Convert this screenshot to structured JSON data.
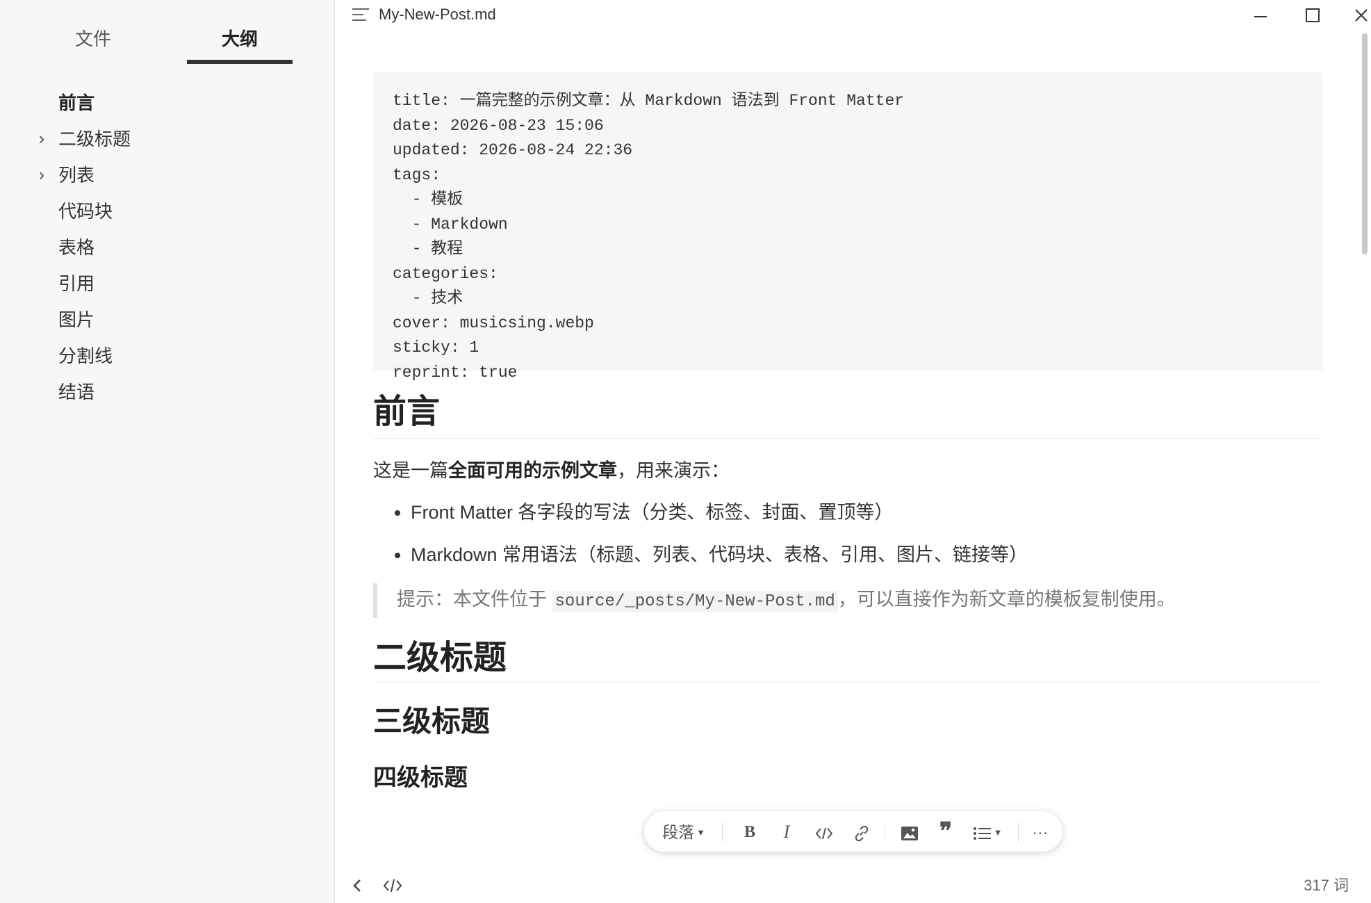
{
  "sidebar": {
    "tabs": [
      "文件",
      "大纲"
    ],
    "outline": [
      {
        "label": "前言",
        "caret": ""
      },
      {
        "label": "二级标题",
        "caret": "›"
      },
      {
        "label": "列表",
        "caret": "›"
      },
      {
        "label": "代码块",
        "caret": ""
      },
      {
        "label": "表格",
        "caret": ""
      },
      {
        "label": "引用",
        "caret": ""
      },
      {
        "label": "图片",
        "caret": ""
      },
      {
        "label": "分割线",
        "caret": ""
      },
      {
        "label": "结语",
        "caret": ""
      }
    ]
  },
  "titlebar": {
    "filename": "My-New-Post.md"
  },
  "editor": {
    "front_matter": "title: 一篇完整的示例文章：从 Markdown 语法到 Front Matter\ndate: 2026-08-23 15:06\nupdated: 2026-08-24 22:36\ntags:\n  - 模板\n  - Markdown\n  - 教程\ncategories:\n  - 技术\ncover: musicsing.webp\nsticky: 1\nreprint: true",
    "h1": "前言",
    "intro_prefix": "这是一篇",
    "intro_bold": "全面可用的示例文章",
    "intro_suffix": "，用来演示：",
    "bullets": [
      "Front Matter 各字段的写法（分类、标签、封面、置顶等）",
      "Markdown 常用语法（标题、列表、代码块、表格、引用、图片、链接等）"
    ],
    "quote_prefix": "提示：本文件位于 ",
    "quote_code": "source/_posts/My-New-Post.md",
    "quote_suffix": "，可以直接作为新文章的模板复制使用。",
    "h2": "二级标题",
    "h3": "三级标题",
    "h4": "四级标题"
  },
  "toolbar": {
    "paragraph": "段落",
    "bold": "B",
    "italic": "I",
    "quote": "❞",
    "more": "···"
  },
  "status": {
    "word_count": "317 词"
  }
}
